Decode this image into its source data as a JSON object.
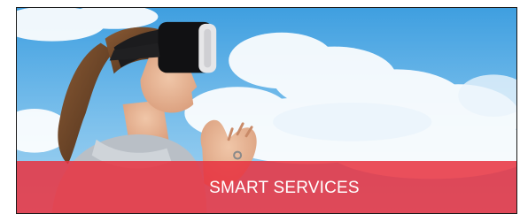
{
  "card": {
    "caption": "SMART SERVICES",
    "image_subject": "woman-wearing-vr-headset",
    "banner_color": "#e83240",
    "sky_color": "#5fb2e6"
  }
}
